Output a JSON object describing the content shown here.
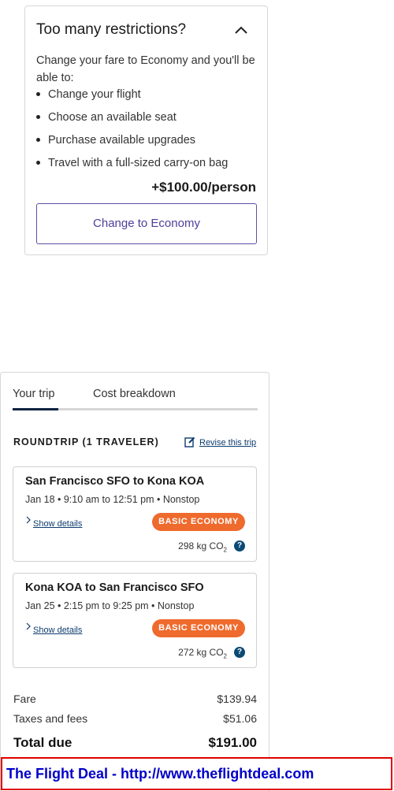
{
  "upsell": {
    "title": "Too many restrictions?",
    "intro": "Change your fare to Economy and you'll be able to:",
    "benefits": [
      "Change your flight",
      "Choose an available seat",
      "Purchase available upgrades",
      "Travel with a full-sized carry-on bag"
    ],
    "price": "+$100.00/person",
    "button_label": "Change to Economy"
  },
  "trip": {
    "tabs": [
      "Your trip",
      "Cost breakdown"
    ],
    "active_tab": "Your trip",
    "heading": "ROUNDTRIP (1 TRAVELER)",
    "revise_label": "Revise this trip",
    "segments": [
      {
        "route": "San Francisco SFO to Kona KOA",
        "time": "Jan 18 • 9:10 am to 12:51 pm • Nonstop",
        "details_label": "Show details",
        "badge": "BASIC ECONOMY",
        "co2_value": "298 kg CO",
        "co2_sub": "2"
      },
      {
        "route": "Kona KOA to San Francisco SFO",
        "time": "Jan 25 • 2:15 pm to 9:25 pm • Nonstop",
        "details_label": "Show details",
        "badge": "BASIC ECONOMY",
        "co2_value": "272 kg CO",
        "co2_sub": "2"
      }
    ],
    "summary": {
      "fare_label": "Fare",
      "fare_value": "$139.94",
      "taxes_label": "Taxes and fees",
      "taxes_value": "$51.06",
      "total_label": "Total due",
      "total_value": "$191.00"
    }
  },
  "banner": {
    "text": "The Flight Deal - http://www.theflightdeal.com"
  },
  "colors": {
    "badge": "#ef6a2d",
    "button_text": "#4b3f9a",
    "tab_indicator": "#0c2340",
    "banner_text": "#0000c8",
    "banner_border": "#e00000"
  },
  "icons": {
    "collapse": "chevron-up-icon",
    "revise": "edit-icon",
    "details": "chevron-right-icon",
    "help": "question-icon"
  }
}
